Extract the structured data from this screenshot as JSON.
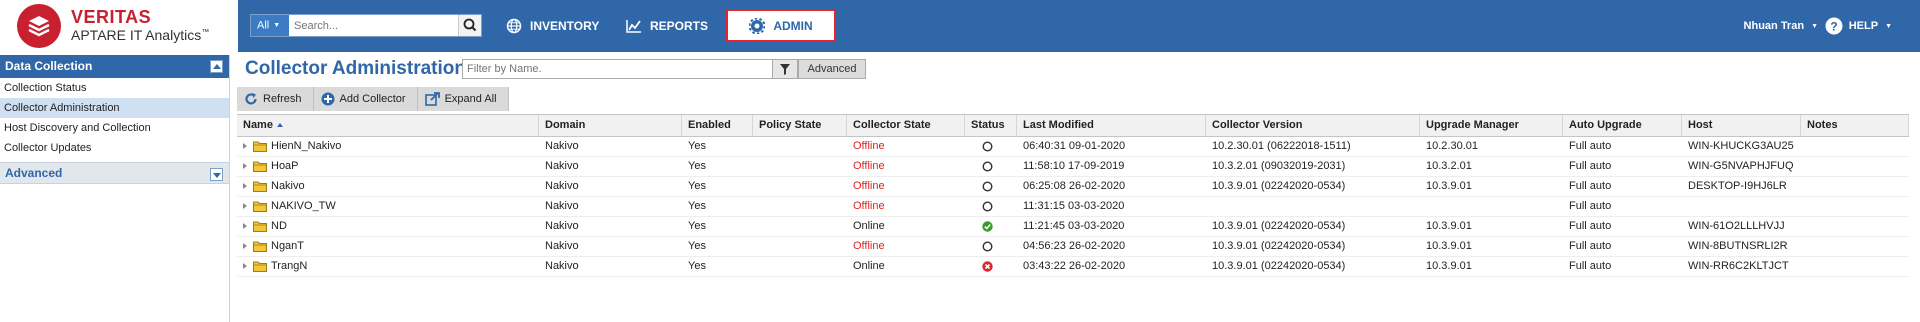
{
  "brand": {
    "name": "VERITAS",
    "product": "APTARE IT Analytics",
    "trademark": "™"
  },
  "search": {
    "scope": "All",
    "placeholder": "Search..."
  },
  "nav": {
    "inventory": "INVENTORY",
    "reports": "REPORTS",
    "admin": "ADMIN",
    "user": "Nhuan Tran",
    "help": "HELP"
  },
  "sidebar": {
    "title": "Data Collection",
    "items": [
      {
        "label": "Collection Status"
      },
      {
        "label": "Collector Administration"
      },
      {
        "label": "Host Discovery and Collection"
      },
      {
        "label": "Collector Updates"
      }
    ],
    "advanced": "Advanced"
  },
  "main": {
    "title": "Collector Administration",
    "filter_placeholder": "Filter by Name.",
    "advanced_label": "Advanced",
    "toolbar": {
      "refresh": "Refresh",
      "add_collector": "Add Collector",
      "expand_all": "Expand All"
    }
  },
  "table": {
    "columns": [
      "Name",
      "Domain",
      "Enabled",
      "Policy State",
      "Collector State",
      "Status",
      "Last Modified",
      "Collector Version",
      "Upgrade Manager",
      "Auto Upgrade",
      "Host",
      "Notes"
    ],
    "rows": [
      {
        "name": "HienN_Nakivo",
        "domain": "Nakivo",
        "enabled": "Yes",
        "policy_state": "",
        "collector_state": "Offline",
        "status": "offline",
        "last_modified": "06:40:31 09-01-2020",
        "collector_version": "10.2.30.01 (06222018-1511)",
        "upgrade_manager": "10.2.30.01",
        "auto_upgrade": "Full auto",
        "host": "WIN-KHUCKG3AU25",
        "notes": ""
      },
      {
        "name": "HoaP",
        "domain": "Nakivo",
        "enabled": "Yes",
        "policy_state": "",
        "collector_state": "Offline",
        "status": "offline",
        "last_modified": "11:58:10 17-09-2019",
        "collector_version": "10.3.2.01 (09032019-2031)",
        "upgrade_manager": "10.3.2.01",
        "auto_upgrade": "Full auto",
        "host": "WIN-G5NVAPHJFUQ",
        "notes": ""
      },
      {
        "name": "Nakivo",
        "domain": "Nakivo",
        "enabled": "Yes",
        "policy_state": "",
        "collector_state": "Offline",
        "status": "offline",
        "last_modified": "06:25:08 26-02-2020",
        "collector_version": "10.3.9.01 (02242020-0534)",
        "upgrade_manager": "10.3.9.01",
        "auto_upgrade": "Full auto",
        "host": "DESKTOP-I9HJ6LR",
        "notes": ""
      },
      {
        "name": "NAKIVO_TW",
        "domain": "Nakivo",
        "enabled": "Yes",
        "policy_state": "",
        "collector_state": "Offline",
        "status": "offline",
        "last_modified": "11:31:15 03-03-2020",
        "collector_version": "",
        "upgrade_manager": "",
        "auto_upgrade": "Full auto",
        "host": "",
        "notes": ""
      },
      {
        "name": "ND",
        "domain": "Nakivo",
        "enabled": "Yes",
        "policy_state": "",
        "collector_state": "Online",
        "status": "ok",
        "last_modified": "11:21:45 03-03-2020",
        "collector_version": "10.3.9.01 (02242020-0534)",
        "upgrade_manager": "10.3.9.01",
        "auto_upgrade": "Full auto",
        "host": "WIN-61O2LLLHVJJ",
        "notes": ""
      },
      {
        "name": "NganT",
        "domain": "Nakivo",
        "enabled": "Yes",
        "policy_state": "",
        "collector_state": "Offline",
        "status": "offline",
        "last_modified": "04:56:23 26-02-2020",
        "collector_version": "10.3.9.01 (02242020-0534)",
        "upgrade_manager": "10.3.9.01",
        "auto_upgrade": "Full auto",
        "host": "WIN-8BUTNSRLI2R",
        "notes": ""
      },
      {
        "name": "TrangN",
        "domain": "Nakivo",
        "enabled": "Yes",
        "policy_state": "",
        "collector_state": "Online",
        "status": "error",
        "last_modified": "03:43:22 26-02-2020",
        "collector_version": "10.3.9.01 (02242020-0534)",
        "upgrade_manager": "10.3.9.01",
        "auto_upgrade": "Full auto",
        "host": "WIN-RR6C2KLTJCT",
        "notes": ""
      }
    ]
  }
}
